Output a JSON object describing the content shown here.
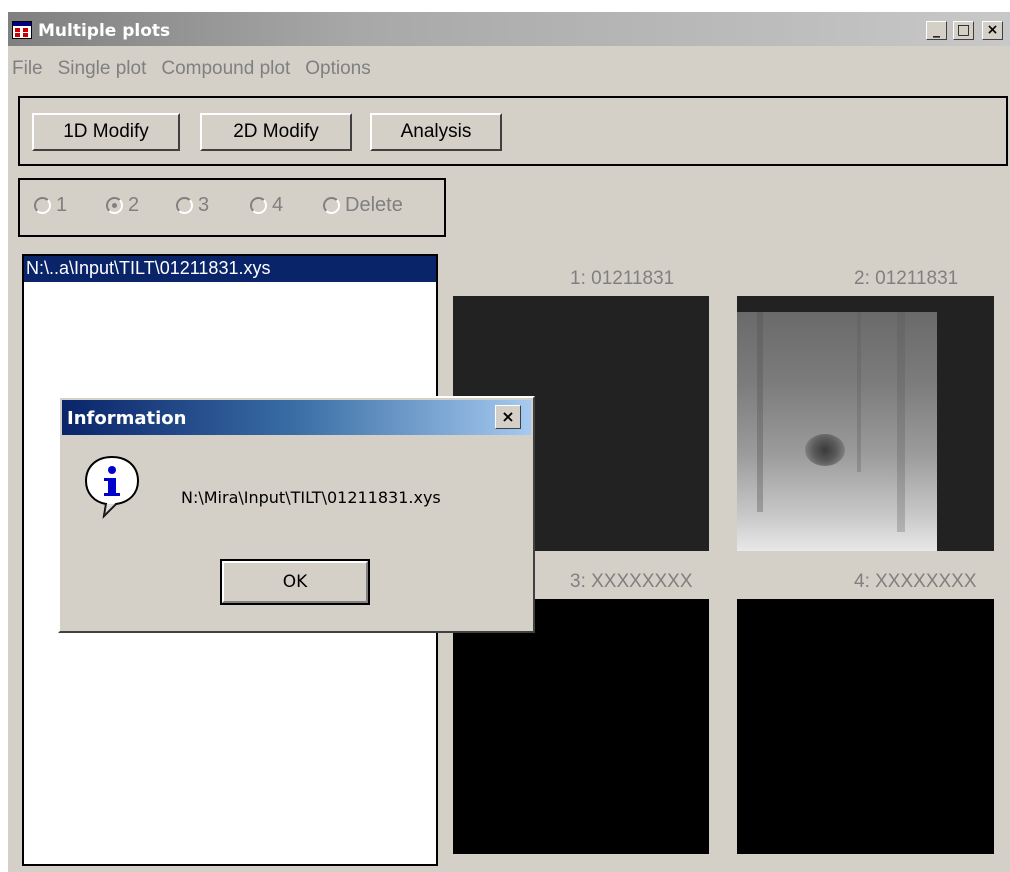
{
  "window": {
    "title": "Multiple plots",
    "minimize_glyph": "_",
    "maximize_glyph": "□",
    "close_glyph": "×"
  },
  "menu": {
    "items": [
      {
        "label": "File"
      },
      {
        "label": "Single plot"
      },
      {
        "label": "Compound plot"
      },
      {
        "label": "Options"
      }
    ]
  },
  "toolbar": {
    "buttons": [
      {
        "label": "1D Modify"
      },
      {
        "label": "2D Modify"
      },
      {
        "label": "Analysis"
      }
    ]
  },
  "radio_group": {
    "options": [
      {
        "label": "1",
        "checked": false
      },
      {
        "label": "2",
        "checked": true
      },
      {
        "label": "3",
        "checked": false
      },
      {
        "label": "4",
        "checked": false
      },
      {
        "label": "Delete",
        "checked": false
      }
    ]
  },
  "file_list": {
    "selected": "N:\\..a\\Input\\TILT\\01211831.xys"
  },
  "plots": [
    {
      "label": "1: 01211831"
    },
    {
      "label": "2: 01211831"
    },
    {
      "label": "3: XXXXXXXX"
    },
    {
      "label": "4: XXXXXXXX"
    }
  ],
  "dialog": {
    "title": "Information",
    "close_glyph": "×",
    "icon": "info-icon",
    "message": "N:\\Mira\\Input\\TILT\\01211831.xys",
    "ok_label": "OK"
  },
  "colors": {
    "dialog_title": "#0a246a",
    "window_face": "#d4d0c8",
    "selection": "#0a246a"
  }
}
